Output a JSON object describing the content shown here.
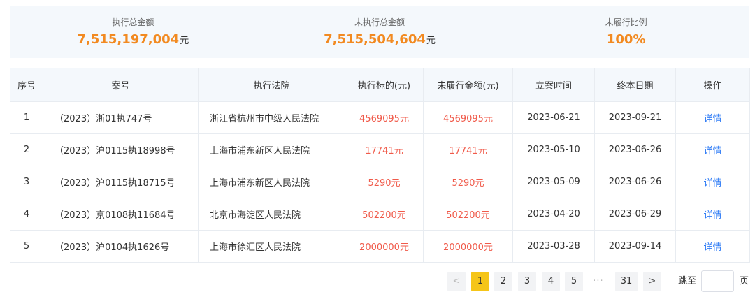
{
  "summary": [
    {
      "label": "执行总金额",
      "value": "7,515,197,004",
      "unit": "元"
    },
    {
      "label": "未执行总金额",
      "value": "7,515,504,604",
      "unit": "元"
    },
    {
      "label": "未履行比例",
      "value": "100%",
      "unit": ""
    }
  ],
  "table": {
    "headers": [
      "序号",
      "案号",
      "执行法院",
      "执行标的(元)",
      "未履行金额(元)",
      "立案时间",
      "终本日期",
      "操作"
    ],
    "rows": [
      {
        "idx": "1",
        "case_no": "（2023）浙01执747号",
        "court": "浙江省杭州市中级人民法院",
        "target": "4569095元",
        "unpaid": "4569095元",
        "filed": "2023-06-21",
        "closed": "2023-09-21",
        "action": "详情"
      },
      {
        "idx": "2",
        "case_no": "（2023）沪0115执18998号",
        "court": "上海市浦东新区人民法院",
        "target": "17741元",
        "unpaid": "17741元",
        "filed": "2023-05-10",
        "closed": "2023-06-26",
        "action": "详情"
      },
      {
        "idx": "3",
        "case_no": "（2023）沪0115执18715号",
        "court": "上海市浦东新区人民法院",
        "target": "5290元",
        "unpaid": "5290元",
        "filed": "2023-05-09",
        "closed": "2023-06-26",
        "action": "详情"
      },
      {
        "idx": "4",
        "case_no": "（2023）京0108执11684号",
        "court": "北京市海淀区人民法院",
        "target": "502200元",
        "unpaid": "502200元",
        "filed": "2023-04-20",
        "closed": "2023-06-29",
        "action": "详情"
      },
      {
        "idx": "5",
        "case_no": "（2023）沪0104执1626号",
        "court": "上海市徐汇区人民法院",
        "target": "2000000元",
        "unpaid": "2000000元",
        "filed": "2023-03-28",
        "closed": "2023-09-14",
        "action": "详情"
      }
    ]
  },
  "pagination": {
    "prev_icon": "chevron-left-icon",
    "next_icon": "chevron-right-icon",
    "prev_glyph": "<",
    "next_glyph": ">",
    "pages": [
      "1",
      "2",
      "3",
      "4",
      "5"
    ],
    "current": "1",
    "ellipsis": "···",
    "last": "31",
    "jump_label": "跳至",
    "jump_value": "",
    "jump_suffix": "页"
  },
  "colors": {
    "accent_amount": "#f28a21",
    "red_amount": "#f05a4a",
    "link": "#2f7cf6",
    "active_page": "#f5c518"
  }
}
